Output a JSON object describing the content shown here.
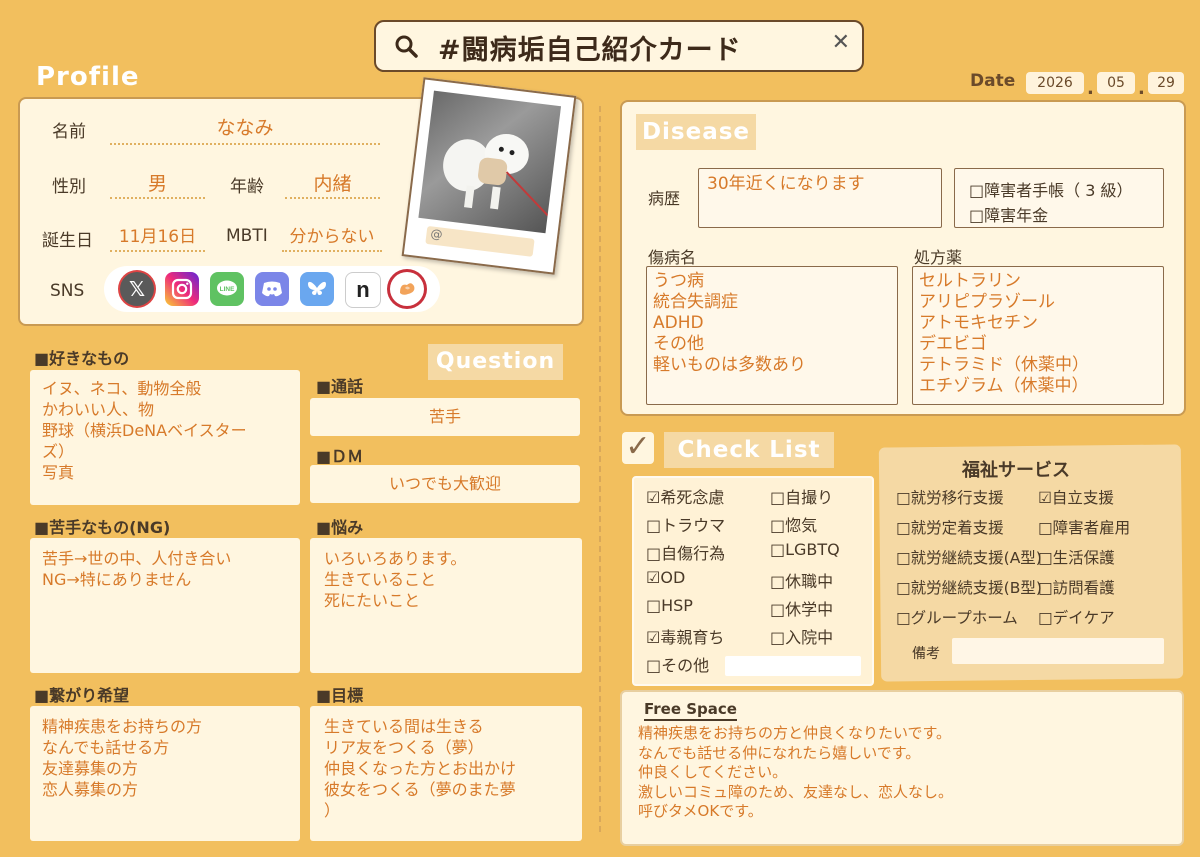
{
  "search": {
    "title": "#闘病垢自己紹介カード",
    "close": "✕"
  },
  "profile": {
    "heading": "Profile",
    "name_label": "名前",
    "name": "ななみ",
    "gender_label": "性別",
    "gender": "男",
    "age_label": "年齢",
    "age": "内緒",
    "birthday_label": "誕生日",
    "birthday": "11月16日",
    "mbti_label": "MBTI",
    "mbti": "分からない",
    "sns_label": "SNS",
    "photo_handle": "@"
  },
  "date": {
    "label": "Date",
    "year": "2026",
    "month": "05",
    "day": "29",
    "sep": "."
  },
  "likes": {
    "title": "■好きなもの",
    "text": "イヌ、ネコ、動物全般\nかわいい人、物\n野球（横浜DeNAベイスター\nズ）\n写真"
  },
  "question": {
    "heading": "Question",
    "call_title": "■通話",
    "call": "苦手",
    "dm_title": "■ＤＭ",
    "dm": "いつでも大歓迎",
    "worry_title": "■悩み",
    "worry": "いろいろあります。\n生きていること\n死にたいこと",
    "goal_title": "■目標",
    "goal": "生きている間は生きる\nリア友をつくる（夢）\n仲良くなった方とお出かけ\n彼女をつくる（夢のまた夢\n）"
  },
  "dislikes": {
    "title": "■苦手なもの(NG)",
    "text": "苦手→世の中、人付き合い\nNG→特にありません"
  },
  "connect": {
    "title": "■繋がり希望",
    "text": "精神疾患をお持ちの方\nなんでも話せる方\n友達募集の方\n恋人募集の方"
  },
  "disease": {
    "heading": "Disease",
    "history_label": "病歴",
    "history": "30年近くになります",
    "handbook": "□障害者手帳（ 3 級）",
    "pension": "□障害年金",
    "diag_label": "傷病名",
    "diag": "うつ病\n統合失調症\nADHD\nその他\n軽いものは多数あり",
    "meds_label": "処方薬",
    "meds": "セルトラリン\nアリピプラゾール\nアトモキセチン\nデエビゴ\nテトラミド（休薬中）\nエチゾラム（休薬中）"
  },
  "checklist": {
    "heading": "Check List",
    "check_glyph": "✓",
    "left": [
      "☑希死念慮",
      "□トラウマ",
      "□自傷行為",
      "☑OD",
      "□HSP",
      "☑毒親育ち",
      "□その他"
    ],
    "right": [
      "□自撮り",
      "□惚気",
      "□LGBTQ",
      "□休職中",
      "□休学中",
      "□入院中"
    ]
  },
  "welfare": {
    "title": "福祉サービス",
    "left": [
      "□就労移行支援",
      "□就労定着支援",
      "□就労継続支援(A型)",
      "□就労継続支援(B型)",
      "□グループホーム"
    ],
    "right": [
      "☑自立支援",
      "□障害者雇用",
      "□生活保護",
      "□訪問看護",
      "□デイケア"
    ],
    "note_label": "備考"
  },
  "free": {
    "title": "Free Space",
    "text": "精神疾患をお持ちの方と仲良くなりたいです。\nなんでも話せる仲になれたら嬉しいです。\n仲良くしてください。\n激しいコミュ障のため、友達なし、恋人なし。\n呼びタメOKです。"
  },
  "sns_icons": [
    "x-icon",
    "instagram-icon",
    "line-icon",
    "discord-icon",
    "bluesky-icon",
    "note-icon",
    "lit-link-icon"
  ],
  "colors": {
    "background": "#f2bf5e",
    "card": "#fff6e0",
    "accent_text": "#d77a2a",
    "ink": "#4a3a28"
  }
}
